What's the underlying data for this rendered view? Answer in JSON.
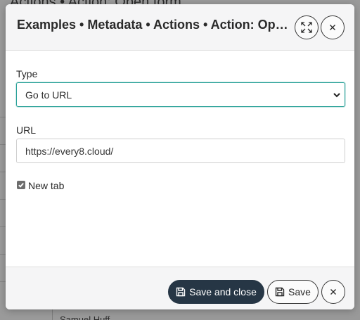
{
  "background": {
    "title": "Actions • Action: Open form",
    "bottom_cell_text": "Samuel Huff"
  },
  "dialog": {
    "title": "Examples • Metadata • Actions • Action: Open fo...",
    "header_buttons": {
      "expand_icon": "expand-icon",
      "close_icon": "close-icon"
    },
    "fields": {
      "type": {
        "label": "Type",
        "value": "Go to URL"
      },
      "url": {
        "label": "URL",
        "value": "https://every8.cloud/"
      },
      "new_tab": {
        "label": "New tab",
        "checked": true
      }
    },
    "footer": {
      "save_close_label": "Save and close",
      "save_label": "Save",
      "save_icon": "floppy-disk-icon",
      "close_icon": "close-icon"
    },
    "colors": {
      "accent_border": "#2aa198",
      "primary_button": "#263645"
    }
  }
}
